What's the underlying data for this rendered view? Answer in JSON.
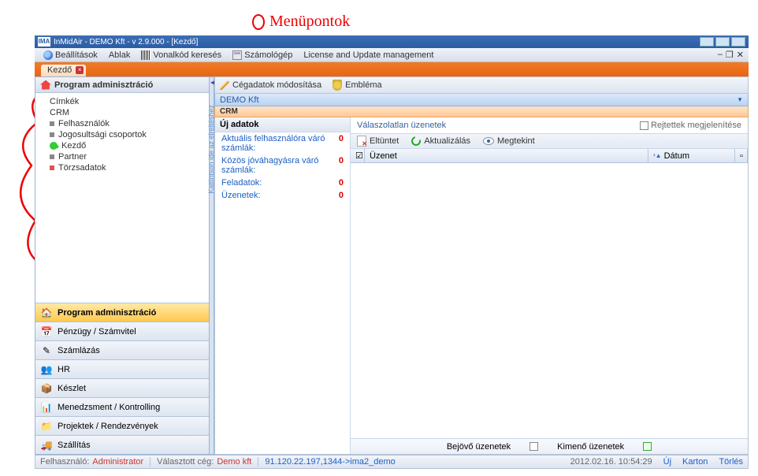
{
  "annotation": {
    "label": "Menüpontok"
  },
  "window": {
    "title": "InMidAir - DEMO Kft - v 2.9.000 - [Kezdő]",
    "logo": "IMA"
  },
  "menu": {
    "items": [
      "Beállítások",
      "Ablak",
      "Vonalkód keresés",
      "Számológép",
      "License and Update management"
    ]
  },
  "tabs": {
    "active": "Kezdő"
  },
  "nav": {
    "header": "Program adminisztráció",
    "items": [
      {
        "label": "Címkék",
        "icon": ""
      },
      {
        "label": "CRM",
        "icon": ""
      },
      {
        "label": "Felhasználók",
        "icon": "sq"
      },
      {
        "label": "Jogosultsági csoportok",
        "icon": "sq"
      },
      {
        "label": "Kezdő",
        "icon": "green"
      },
      {
        "label": "Partner",
        "icon": "sq"
      },
      {
        "label": "Törzsadatok",
        "icon": "red"
      }
    ]
  },
  "modules": [
    {
      "label": "Program adminisztráció",
      "icon": "🏠",
      "active": true
    },
    {
      "label": "Pénzügy / Számvitel",
      "icon": "📅"
    },
    {
      "label": "Számlázás",
      "icon": "✎"
    },
    {
      "label": "HR",
      "icon": "👥"
    },
    {
      "label": "Készlet",
      "icon": "📦"
    },
    {
      "label": "Menedzsment / Kontrolling",
      "icon": "📊"
    },
    {
      "label": "Projektek / Rendezvények",
      "icon": "📁"
    },
    {
      "label": "Szállítás",
      "icon": "🚚"
    }
  ],
  "splitter": {
    "hint": "Kattintson ide az elrejtéshez"
  },
  "toolbar": {
    "edit": "Cégadatok módosítása",
    "emblem": "Embléma"
  },
  "company": "DEMO Kft",
  "section": "CRM",
  "newdata": {
    "header": "Új adatok",
    "rows": [
      {
        "label": "Aktuális felhasználóra váró számlák:",
        "count": "0"
      },
      {
        "label": "Közös jóváhagyásra váró számlák:",
        "count": "0"
      },
      {
        "label": "Feladatok:",
        "count": "0"
      },
      {
        "label": "Üzenetek:",
        "count": "0"
      }
    ]
  },
  "messages": {
    "title": "Válaszolatlan üzenetek",
    "showHidden": "Rejtettek megjelenítése",
    "buttons": {
      "hide": "Eltüntet",
      "refresh": "Aktualizálás",
      "view": "Megtekint"
    },
    "columns": {
      "msg": "Üzenet",
      "date": "Dátum"
    },
    "filters": {
      "in": "Bejövő üzenetek",
      "out": "Kimenő üzenetek"
    }
  },
  "status": {
    "userLabel": "Felhasználó:",
    "user": "Administrator",
    "companyLabel": "Választott cég:",
    "company": "Demo kft",
    "conn": "91.120.22.197,1344->ima2_demo",
    "time": "2012.02.16. 10:54:29",
    "links": [
      "Új",
      "Karton",
      "Törlés"
    ]
  }
}
